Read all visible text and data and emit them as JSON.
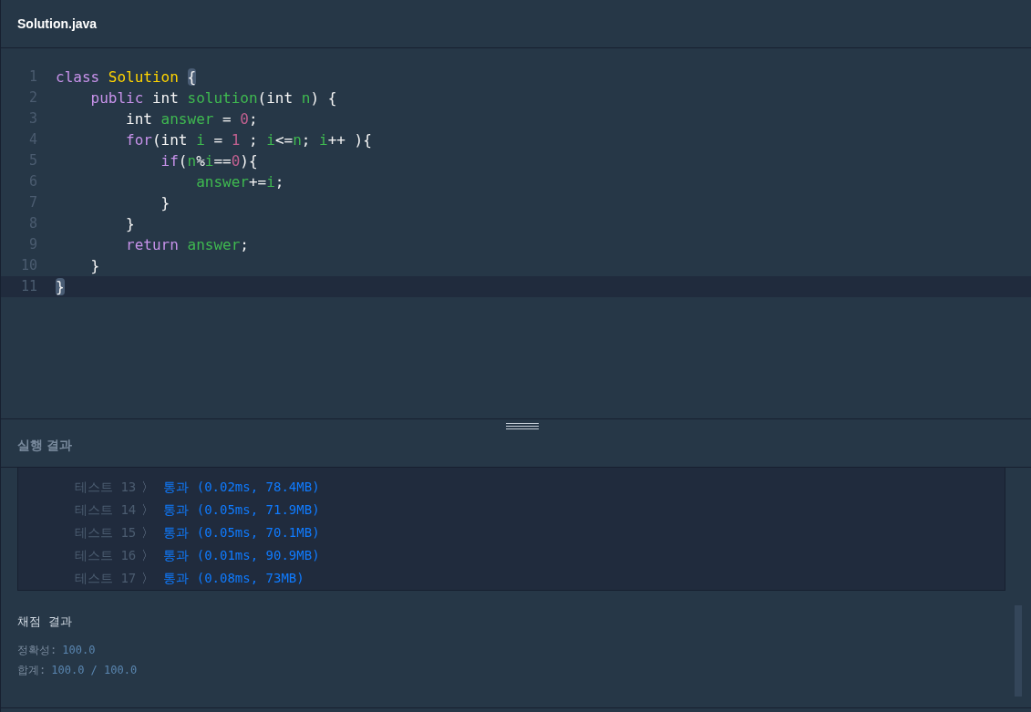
{
  "file_tab": {
    "title": "Solution.java"
  },
  "editor": {
    "lines": [
      {
        "number": "1",
        "active": false,
        "tokens": [
          {
            "kind": "keyword",
            "text": "class "
          },
          {
            "kind": "type",
            "text": "Solution "
          },
          {
            "kind": "matched-bracket",
            "text": "{"
          }
        ]
      },
      {
        "number": "2",
        "active": false,
        "tokens": [
          {
            "kind": "keyword",
            "text": "    public"
          },
          {
            "kind": "plain",
            "text": " int "
          },
          {
            "kind": "ident",
            "text": "solution"
          },
          {
            "kind": "plain",
            "text": "(int "
          },
          {
            "kind": "ident",
            "text": "n"
          },
          {
            "kind": "plain",
            "text": ") {"
          }
        ]
      },
      {
        "number": "3",
        "active": false,
        "tokens": [
          {
            "kind": "plain",
            "text": "        int "
          },
          {
            "kind": "ident",
            "text": "answer"
          },
          {
            "kind": "plain",
            "text": " = "
          },
          {
            "kind": "number",
            "text": "0"
          },
          {
            "kind": "plain",
            "text": ";"
          }
        ]
      },
      {
        "number": "4",
        "active": false,
        "tokens": [
          {
            "kind": "keyword",
            "text": "        for"
          },
          {
            "kind": "plain",
            "text": "(int "
          },
          {
            "kind": "ident",
            "text": "i"
          },
          {
            "kind": "plain",
            "text": " = "
          },
          {
            "kind": "number",
            "text": "1"
          },
          {
            "kind": "plain",
            "text": " ; "
          },
          {
            "kind": "ident",
            "text": "i"
          },
          {
            "kind": "plain",
            "text": "<="
          },
          {
            "kind": "ident",
            "text": "n"
          },
          {
            "kind": "plain",
            "text": "; "
          },
          {
            "kind": "ident",
            "text": "i"
          },
          {
            "kind": "plain",
            "text": "++ ){"
          }
        ]
      },
      {
        "number": "5",
        "active": false,
        "tokens": [
          {
            "kind": "keyword",
            "text": "            if"
          },
          {
            "kind": "plain",
            "text": "("
          },
          {
            "kind": "ident",
            "text": "n"
          },
          {
            "kind": "plain",
            "text": "%"
          },
          {
            "kind": "ident",
            "text": "i"
          },
          {
            "kind": "plain",
            "text": "=="
          },
          {
            "kind": "number",
            "text": "0"
          },
          {
            "kind": "plain",
            "text": "){"
          }
        ]
      },
      {
        "number": "6",
        "active": false,
        "tokens": [
          {
            "kind": "ident",
            "text": "                answer"
          },
          {
            "kind": "plain",
            "text": "+="
          },
          {
            "kind": "ident",
            "text": "i"
          },
          {
            "kind": "plain",
            "text": ";"
          }
        ]
      },
      {
        "number": "7",
        "active": false,
        "tokens": [
          {
            "kind": "plain",
            "text": "            }"
          }
        ]
      },
      {
        "number": "8",
        "active": false,
        "tokens": [
          {
            "kind": "plain",
            "text": "        }"
          }
        ]
      },
      {
        "number": "9",
        "active": false,
        "tokens": [
          {
            "kind": "keyword",
            "text": "        return "
          },
          {
            "kind": "ident",
            "text": "answer"
          },
          {
            "kind": "plain",
            "text": ";"
          }
        ]
      },
      {
        "number": "10",
        "active": false,
        "tokens": [
          {
            "kind": "plain",
            "text": "    }"
          }
        ]
      },
      {
        "number": "11",
        "active": true,
        "tokens": [
          {
            "kind": "matched-bracket",
            "text": "}"
          }
        ]
      }
    ]
  },
  "run_results": {
    "title": "실행 결과",
    "tests": [
      {
        "label": "테스트 13",
        "arrow": "〉",
        "result": "통과 (0.02ms, 78.4MB)"
      },
      {
        "label": "테스트 14",
        "arrow": "〉",
        "result": "통과 (0.05ms, 71.9MB)"
      },
      {
        "label": "테스트 15",
        "arrow": "〉",
        "result": "통과 (0.05ms, 70.1MB)"
      },
      {
        "label": "테스트 16",
        "arrow": "〉",
        "result": "통과 (0.01ms, 90.9MB)"
      },
      {
        "label": "테스트 17",
        "arrow": "〉",
        "result": "통과 (0.08ms, 73MB)"
      }
    ]
  },
  "grading": {
    "title": "채점 결과",
    "rows": [
      {
        "label": "정확성:",
        "value": "100.0"
      },
      {
        "label": "합계:",
        "value": "100.0 / 100.0"
      }
    ]
  }
}
